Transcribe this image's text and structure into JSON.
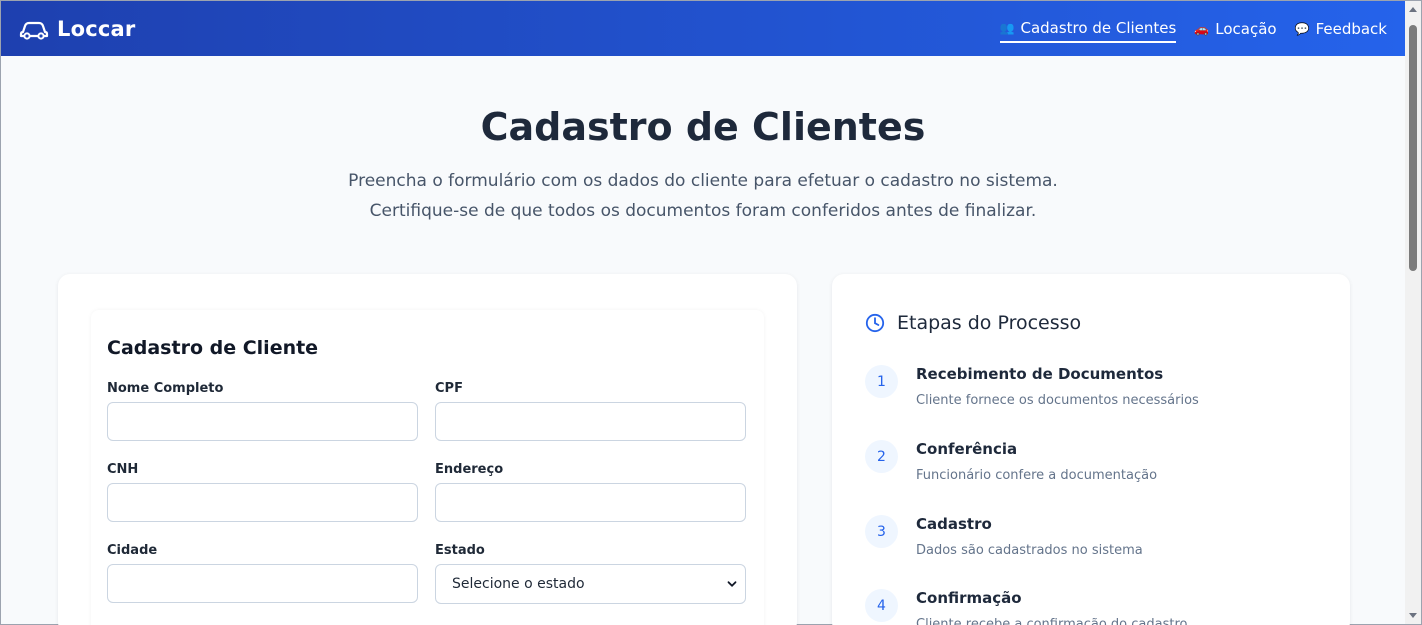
{
  "navbar": {
    "brand": "Loccar",
    "items": [
      {
        "icon": "👥",
        "label": "Cadastro de Clientes",
        "active": true
      },
      {
        "icon": "🚗",
        "label": "Locação"
      },
      {
        "icon": "💬",
        "label": "Feedback"
      }
    ]
  },
  "hero": {
    "title": "Cadastro de Clientes",
    "subtitle_line1": "Preencha o formulário com os dados do cliente para efetuar o cadastro no sistema.",
    "subtitle_line2": "Certifique-se de que todos os documentos foram conferidos antes de finalizar."
  },
  "form": {
    "title": "Cadastro de Cliente",
    "fields": {
      "nome": {
        "label": "Nome Completo",
        "value": ""
      },
      "cpf": {
        "label": "CPF",
        "value": ""
      },
      "cnh": {
        "label": "CNH",
        "value": ""
      },
      "endereco": {
        "label": "Endereço",
        "value": ""
      },
      "cidade": {
        "label": "Cidade",
        "value": ""
      },
      "estado": {
        "label": "Estado",
        "selected": "Selecione o estado"
      }
    }
  },
  "steps": {
    "title": "Etapas do Processo",
    "items": [
      {
        "num": "1",
        "title": "Recebimento de Documentos",
        "desc": "Cliente fornece os documentos necessários"
      },
      {
        "num": "2",
        "title": "Conferência",
        "desc": "Funcionário confere a documentação"
      },
      {
        "num": "3",
        "title": "Cadastro",
        "desc": "Dados são cadastrados no sistema"
      },
      {
        "num": "4",
        "title": "Confirmação",
        "desc": "Cliente recebe a confirmação do cadastro"
      }
    ]
  },
  "colors": {
    "nav_start": "#1e40af",
    "nav_end": "#2563eb",
    "accent": "#2563eb"
  }
}
